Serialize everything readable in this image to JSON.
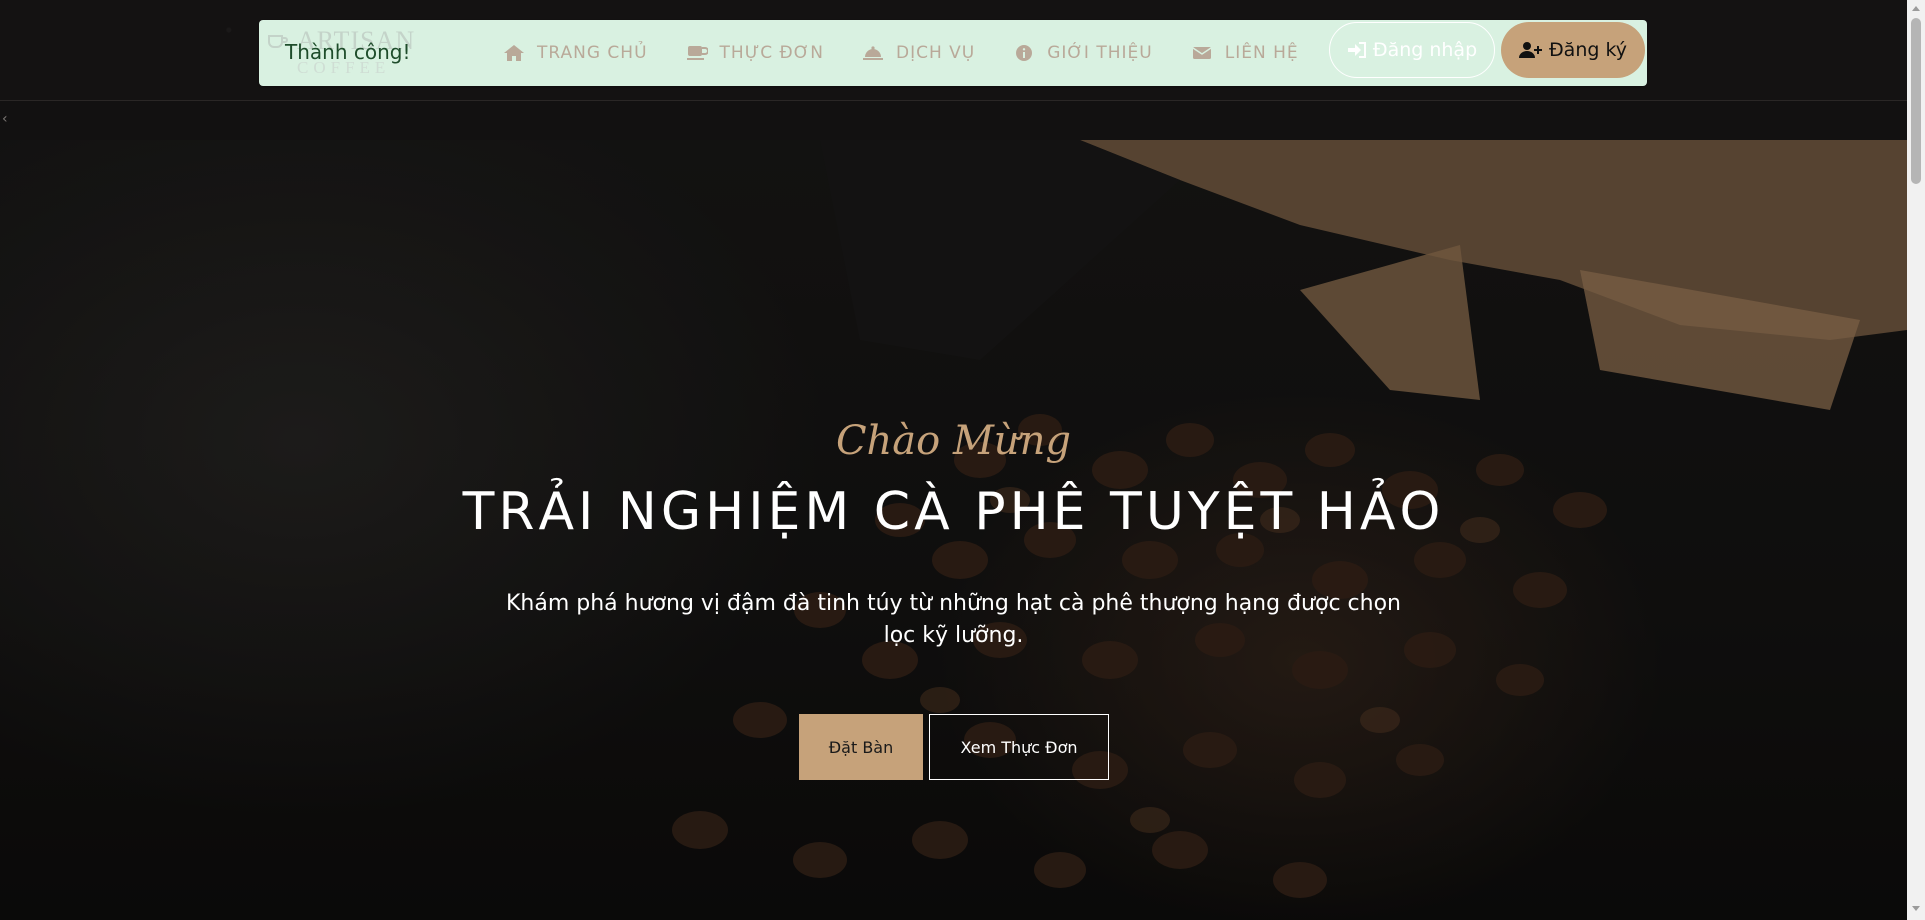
{
  "brand": {
    "title": "ARTISAN",
    "subtitle": "COFFEE",
    "icon": "coffee-cup-icon"
  },
  "toast": {
    "message": "Thành công!"
  },
  "nav": {
    "items": [
      {
        "label": "TRANG CHỦ",
        "icon": "home-icon"
      },
      {
        "label": "THỰC ĐƠN",
        "icon": "coffee-mug-icon"
      },
      {
        "label": "DỊCH VỤ",
        "icon": "cloche-icon"
      },
      {
        "label": "GIỚI THIỆU",
        "icon": "info-circle-icon"
      },
      {
        "label": "LIÊN HỆ",
        "icon": "envelope-icon"
      }
    ],
    "login_label": "Đăng nhập",
    "login_icon": "sign-in-icon",
    "signup_label": "Đăng ký",
    "signup_icon": "user-plus-icon"
  },
  "hero": {
    "eyebrow": "Chào Mừng",
    "title": "TRẢI NGHIỆM CÀ PHÊ TUYỆT HẢO",
    "description": "Khám phá hương vị đậm đà tinh túy từ những hạt cà phê thượng hạng được chọn lọc kỹ lưỡng.",
    "primary_button": "Đặt Bàn",
    "secondary_button": "Xem Thực Đơn"
  },
  "colors": {
    "accent": "#c6a27a",
    "navbar_bg": "#d9f1e1",
    "toast_text": "#1e4d2b",
    "nav_text": "#b9a999"
  }
}
